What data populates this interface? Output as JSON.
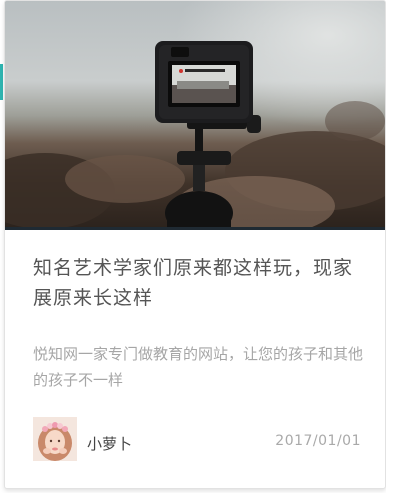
{
  "article": {
    "title": "知名艺术学家们原来都这样玩，现家展原来长这样",
    "description": "悦知网一家专门做教育的网站，让您的孩子和其他的孩子不一样",
    "author": "小萝卜",
    "date": "2017/01/01",
    "hero_image": "action-camera-on-tripod-photo",
    "avatar_image": "girl-with-flower-crown-avatar"
  },
  "colors": {
    "title": "#555555",
    "description": "#a6a6a6",
    "date": "#a9a9a9",
    "accent": "#2fb5b1"
  }
}
